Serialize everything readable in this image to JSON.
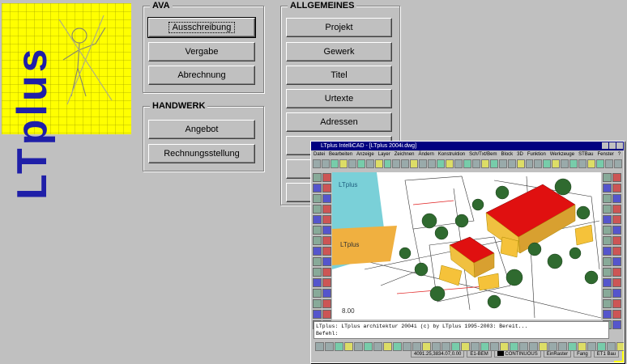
{
  "logo": {
    "text": "LTplus"
  },
  "ava": {
    "title": "AVA",
    "buttons": [
      "Ausschreibung",
      "Vergabe",
      "Abrechnung"
    ]
  },
  "handwerk": {
    "title": "HANDWERK",
    "buttons": [
      "Angebot",
      "Rechnungsstellung"
    ]
  },
  "allgemeines": {
    "title": "ALLGEMEINES",
    "buttons": [
      "Projekt",
      "Gewerk",
      "Titel",
      "Urtexte",
      "Adressen"
    ]
  },
  "cad": {
    "title": "LTplus IntelliCAD - [LTplus 2004i.dwg]",
    "menu": [
      "Datei",
      "Bearbeiten",
      "Anzeige",
      "Layer",
      "Zeichnen",
      "Ändern",
      "Konstruktion",
      "Sch/Txt/Bem",
      "Block",
      "3D",
      "Funktion",
      "Werkzeuge",
      "STBau",
      "Fenster",
      "?"
    ],
    "panel_label": "LTplus",
    "panel_label2": "LTplus",
    "command_line": "LTplus: LTplus architektur 2004i (c) by LTplus 1995-2003: Bereit...",
    "command_prompt": "Befehl:",
    "status": {
      "coords": "4091.25,3834.07,0.00",
      "layer": "E1-BEM",
      "linetype": "CONTINUOUS",
      "mode1": "EinRaster",
      "mode2": "Fang",
      "mode3": "ET1 Bau"
    },
    "dim_label": "8.00"
  },
  "colors": {
    "background": "#c0c0c0",
    "logo_yellow": "#ffff00",
    "logo_blue": "#1f1fa8",
    "titlebar": "#000080",
    "roof_red": "#e01010",
    "wall_yellow": "#f0c040",
    "tree_green": "#2f6a2f"
  }
}
